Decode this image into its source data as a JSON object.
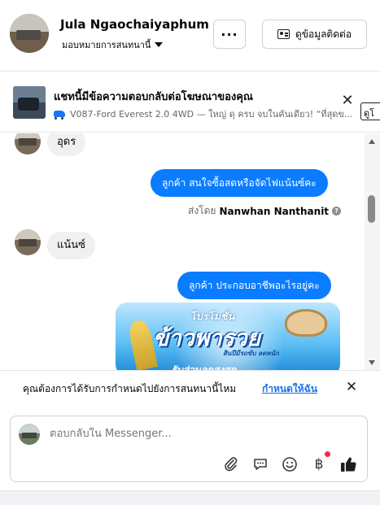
{
  "header": {
    "name": "Jula Ngaochaiyaphum",
    "assign_label": "มอบหมายการสนทนานี้",
    "more_label": "···",
    "contact_label": "ดูข้อมูลติดต่อ"
  },
  "ad_banner": {
    "title": "แชทนี้มีข้อความตอบกลับต่อโฆษณาของคุณ",
    "subtitle": "V087-Ford Everest 2.0 4WD — ใหญ่ ดุ ครบ จบในคันเดียว! “ที่สุดข...",
    "close_label": "✕",
    "link_label": "ดูโ"
  },
  "messages": [
    {
      "direction": "in",
      "text": "อุดร"
    },
    {
      "direction": "out",
      "text": "ลูกค้า สนใจซื้อสดหรือจัดไฟแน้นซ์คะ"
    },
    {
      "direction": "in",
      "text": "แน้นซ์"
    },
    {
      "direction": "out",
      "text": "ลูกค้า ประกอบอาชีพอะไรอยู่คะ"
    }
  ],
  "sent_by": {
    "prefix": "ส่งโดย",
    "name": "Nanwhan Nanthanit",
    "help": "?"
  },
  "promo_image": {
    "small_text": "โปรโมชั่น",
    "big_text": "ข้าวพารวย",
    "tag_text": "สินปีมีรถขับ ลดหนัก",
    "bottom_text": "รับส่วนลดสูงสุด"
  },
  "notification": {
    "text": "คุณต้องการได้รับการกำหนดไปยังการสนทนานี้ไหม",
    "link": "กำหนดให้ฉัน",
    "close_label": "✕"
  },
  "composer": {
    "placeholder": "ตอบกลับใน Messenger...",
    "currency_label": "฿"
  },
  "colors": {
    "accent": "#0a7cff",
    "link": "#1b74e4",
    "incoming_bubble": "#f0f0f0",
    "notification_dot": "#f02849"
  }
}
